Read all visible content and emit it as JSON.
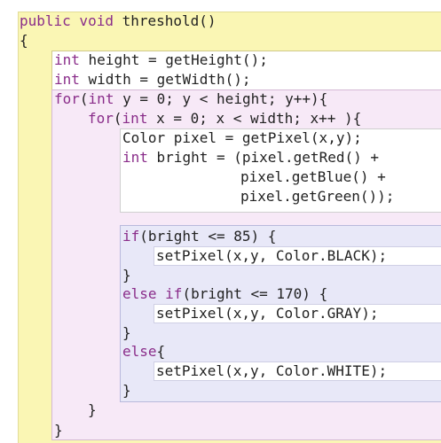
{
  "code": {
    "signature": {
      "mods": "public void",
      "name": " threshold()"
    },
    "open_method": "{",
    "l_height": {
      "kw": "int",
      "rest": " height = getHeight();"
    },
    "l_width": {
      "kw": "int",
      "rest": " width = getWidth();"
    },
    "l_for_y": {
      "kw1": "for",
      "a": "(",
      "kw2": "int",
      "rest": " y = 0; y < height; y++){"
    },
    "l_for_x": {
      "kw1": "for",
      "a": "(",
      "kw2": "int",
      "rest": " x = 0; x < width; x++ ){"
    },
    "l_pixel": "Color pixel = getPixel(x,y);",
    "l_bright": {
      "kw": "int",
      "rest": " bright = (pixel.getRed() +"
    },
    "l_blue": "pixel.getBlue() +",
    "l_green": "pixel.getGreen());",
    "l_if": {
      "kw": "if",
      "rest": "(bright <= 85) {"
    },
    "l_set_black": "setPixel(x,y, Color.BLACK);",
    "l_close_if": "}",
    "l_elseif": {
      "kw1": "else",
      "kw2": " if",
      "rest": "(bright <= 170) {"
    },
    "l_set_gray": "setPixel(x,y, Color.GRAY);",
    "l_close_elseif": "}",
    "l_else": {
      "kw": "else",
      "rest": "{"
    },
    "l_set_white": "setPixel(x,y, Color.WHITE);",
    "l_close_else": "}",
    "l_close_for_x": "}",
    "l_close_for_y": "}"
  }
}
